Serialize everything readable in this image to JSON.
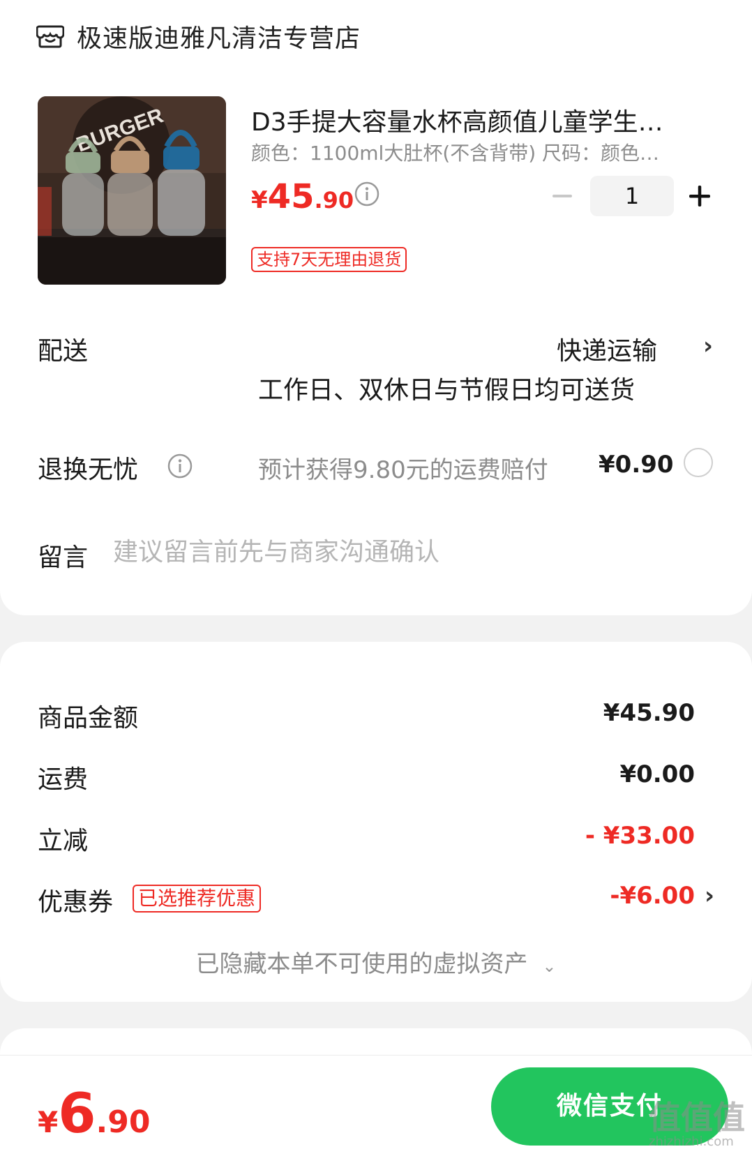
{
  "store": {
    "name": "极速版迪雅凡清洁专营店",
    "icon": "store-icon"
  },
  "product": {
    "title": "D3手提大容量水杯高颜值儿童学生…",
    "spec": "颜色：1100ml大肚杯(不含背带)   尺码：颜色…",
    "price_currency": "¥",
    "price_int": "45",
    "price_dec": ".90",
    "quantity": "1",
    "return_tag": "支持7天无理由退货"
  },
  "delivery": {
    "label": "配送",
    "method": "快递运输",
    "note": "工作日、双休日与节假日均可送货"
  },
  "return_service": {
    "label": "退换无忧",
    "note": "预计获得9.80元的运费赔付",
    "price": "¥0.90",
    "selected": false
  },
  "message": {
    "label": "留言",
    "placeholder": "建议留言前先与商家沟通确认"
  },
  "summary": {
    "goods_label": "商品金额",
    "goods_value": "¥45.90",
    "shipping_label": "运费",
    "shipping_value": "¥0.00",
    "discount_label": "立减",
    "discount_value": "- ¥33.00",
    "coupon_label": "优惠券",
    "coupon_tag": "已选推荐优惠",
    "coupon_value": "-¥6.00",
    "hidden_assets": "已隐藏本单不可使用的虚拟资产"
  },
  "footer": {
    "total_currency": "¥",
    "total_int": "6",
    "total_dec": ".90",
    "pay_label": "微信支付"
  },
  "watermark": {
    "logo": "值值值",
    "domain": "zhizhizhi.com"
  },
  "colors": {
    "accent_red": "#ee2a24",
    "pay_green": "#22c55e"
  }
}
